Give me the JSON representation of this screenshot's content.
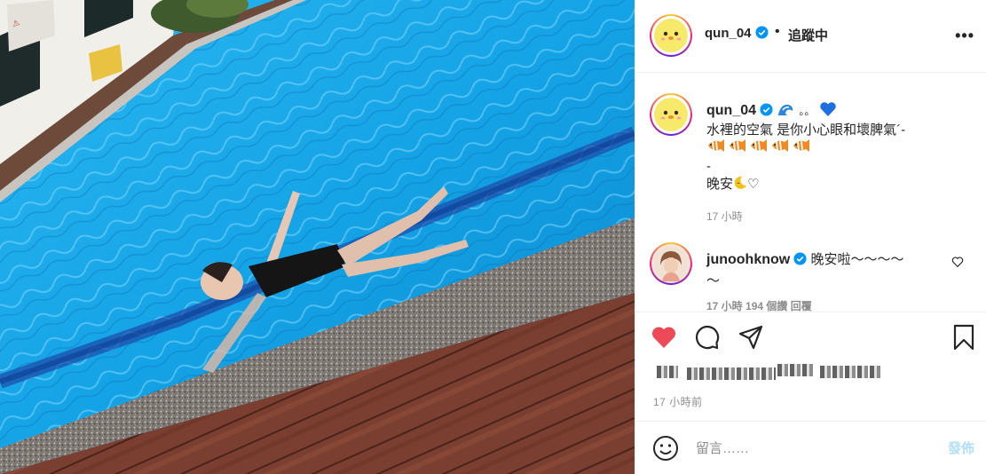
{
  "post": {
    "username": "qun_04",
    "verified": true,
    "separator": "•",
    "follow_status": "追蹤中",
    "more_icon": "ellipsis-icon"
  },
  "caption": {
    "username": "qun_04",
    "line1_suffix": "。。",
    "line2": "水裡的空氣 是你小心眼和壞脾氣´-",
    "fish_count": 5,
    "line4": "-",
    "line5": "晚安",
    "line5_suffix": "♡",
    "time": "17 小時"
  },
  "comments": [
    {
      "username": "junoohknow",
      "verified": true,
      "text_line1": "晚安啦～～～～",
      "text_line2": "～",
      "meta": "17 小時   194 個讚   回覆"
    }
  ],
  "actions": {
    "liked": true,
    "like_icon": "heart-filled-icon",
    "comment_icon": "comment-bubble-icon",
    "share_icon": "paper-plane-icon",
    "save_icon": "bookmark-icon",
    "like_color": "#ed4956"
  },
  "post_time": "17 小時前",
  "add_comment": {
    "placeholder": "留言……",
    "post_label": "發佈"
  },
  "colors": {
    "accent_blue": "#0095f6",
    "post_button_disabled": "#b2dffc",
    "text_secondary": "#8e8e8e"
  }
}
